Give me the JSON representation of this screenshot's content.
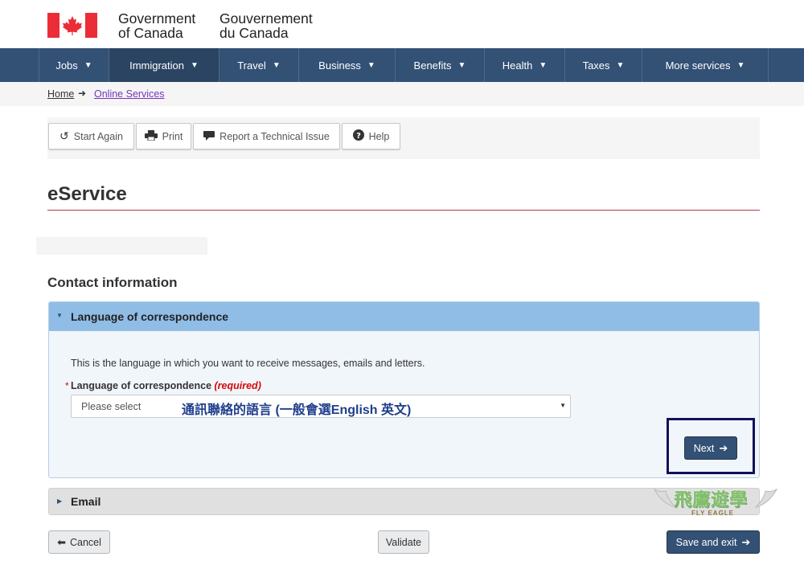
{
  "header": {
    "en_line1": "Government",
    "en_line2": "of Canada",
    "fr_line1": "Gouvernement",
    "fr_line2": "du Canada"
  },
  "menu": {
    "items": [
      {
        "label": "Jobs",
        "active": false
      },
      {
        "label": "Immigration",
        "active": true
      },
      {
        "label": "Travel",
        "active": false
      },
      {
        "label": "Business",
        "active": false
      },
      {
        "label": "Benefits",
        "active": false
      },
      {
        "label": "Health",
        "active": false
      },
      {
        "label": "Taxes",
        "active": false
      },
      {
        "label": "More services",
        "active": false
      }
    ]
  },
  "breadcrumb": {
    "home": "Home",
    "current": "Online Services"
  },
  "toolbar": {
    "start_again": "Start Again",
    "print": "Print",
    "report": "Report a Technical Issue",
    "help": "Help"
  },
  "page": {
    "title": "eService",
    "section": "Contact information"
  },
  "language_panel": {
    "title": "Language of correspondence",
    "description": "This is the language in which you want to receive messages, emails and letters.",
    "field_label": "Language of correspondence",
    "required_text": "(required)",
    "select_value": "Please select",
    "annotation": "通訊聯絡的語言 (一般會選English 英文)",
    "next_label": "Next"
  },
  "email_panel": {
    "title": "Email"
  },
  "watermark": {
    "cn": "飛鷹遊學",
    "en": "FLY EAGLE"
  },
  "actions": {
    "cancel": "Cancel",
    "validate": "Validate",
    "save_exit": "Save and exit"
  },
  "colors": {
    "menu_bg": "#335075",
    "menu_active": "#2a4462",
    "primary_button": "#335075",
    "panel_header": "#8fbde6",
    "title_rule": "#af3c43",
    "required": "#d3080c",
    "visited_link": "#7834bc",
    "highlight_box": "#121258"
  },
  "icons": {
    "start_again": "refresh-icon",
    "print": "printer-icon",
    "report": "comment-icon",
    "help": "question-circle-icon",
    "menu_caret": "chevron-down-icon",
    "breadcrumb_sep": "arrow-right-icon"
  }
}
